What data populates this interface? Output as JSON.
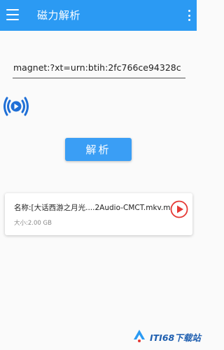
{
  "app_bar": {
    "title": "磁力解析",
    "menu_icon": "hamburger-menu-icon",
    "overflow_icon": "more-vertical-icon",
    "color": "#2b9af3"
  },
  "magnet": {
    "value": "magnet:?xt=urn:btih:2fc766ce94328c"
  },
  "audio_button": {
    "icon": "audio-play-icon",
    "color": "#1f6fd6"
  },
  "parse_button": {
    "label": "解析",
    "color": "#3a9ef5"
  },
  "result": {
    "name": "名称:[大话西游之月光....2Audio-CMCT.mkv.m",
    "size": "大小:2.00 GB",
    "play_icon": "play-circle-icon",
    "play_color": "#e53935"
  },
  "watermark": {
    "text": "ITI68下载站",
    "icon": "site-logo-icon"
  }
}
